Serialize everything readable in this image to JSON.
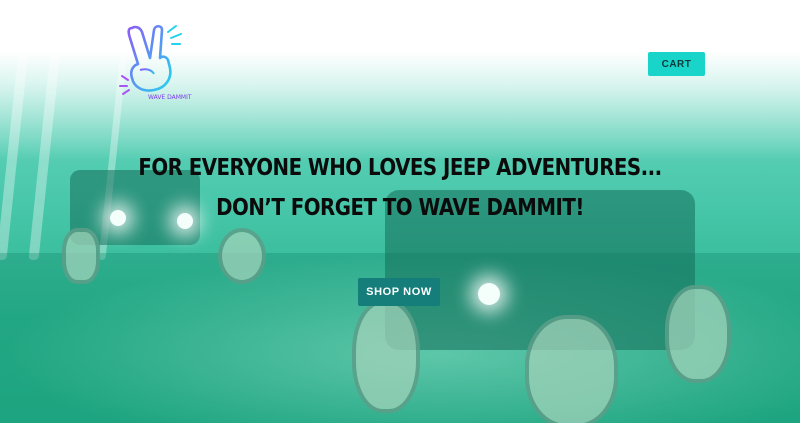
{
  "header": {
    "logo_text": "WAVE DAMMIT",
    "cart_label": "CART"
  },
  "hero": {
    "headline_line1": "FOR EVERYONE WHO LOVES JEEP ADVENTURES...",
    "headline_line2": "DON’T FORGET TO WAVE DAMMIT!",
    "cta_label": "SHOP NOW"
  },
  "colors": {
    "accent": "#19d4c9",
    "cta_bg": "#157e7a",
    "overlay": "#2ab58f"
  },
  "icons": [
    "peace-hand-logo-icon"
  ]
}
